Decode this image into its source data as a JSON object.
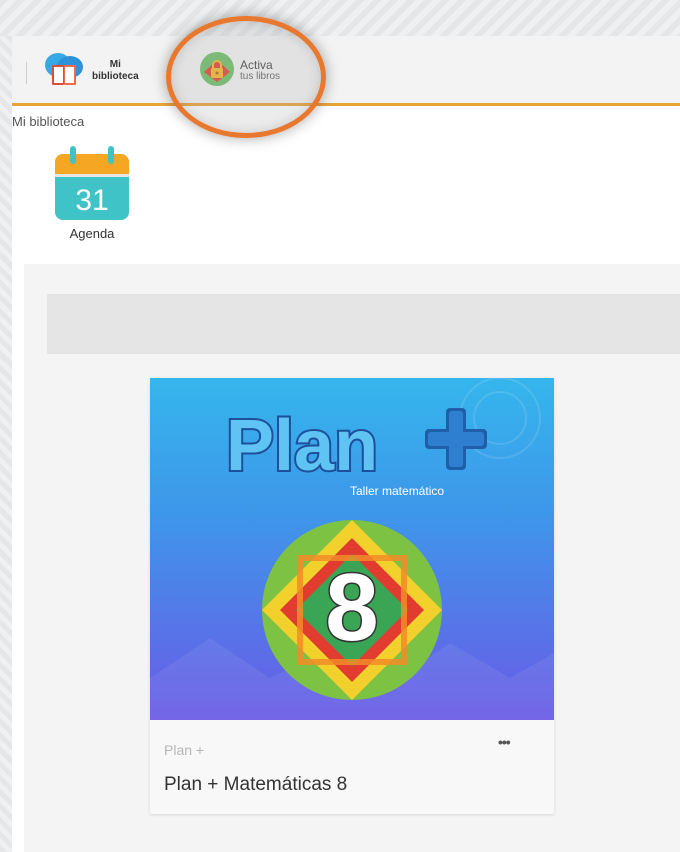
{
  "nav": {
    "mi_line1": "Mi",
    "mi_line2": "biblioteca",
    "activa_line1": "Activa",
    "activa_line2": "tus libros"
  },
  "breadcrumb": "Mi biblioteca",
  "agenda": {
    "day": "31",
    "label": "Agenda"
  },
  "book": {
    "cover_title": "Plan",
    "cover_subtitle": "Taller matemático",
    "cover_number": "8",
    "series": "Plan +",
    "more": "•••",
    "title": "Plan + Matemáticas 8"
  },
  "colors": {
    "accent": "#e8a43a",
    "highlight": "#e8782e",
    "agenda_teal": "#3fc3c6",
    "agenda_header": "#f5a623"
  }
}
